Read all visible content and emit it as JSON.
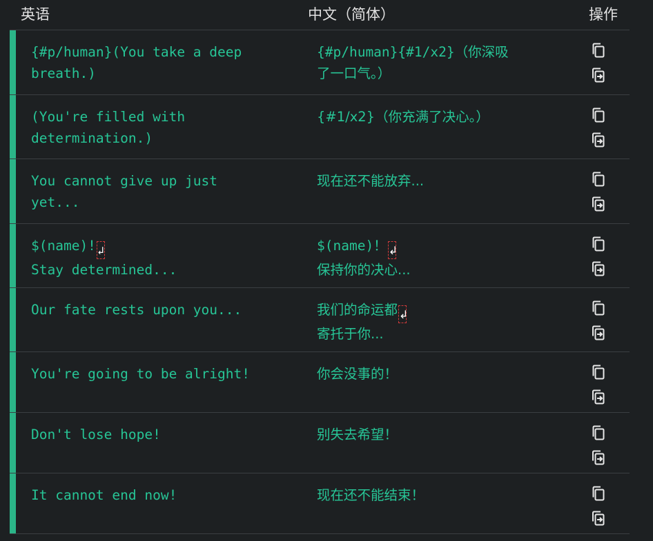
{
  "header": {
    "col_english": "英语",
    "col_chinese": "中文（简体）",
    "col_actions": "操作"
  },
  "rows": [
    {
      "en_lines": [
        "{#p/human}(You take a deep",
        "breath.)"
      ],
      "zh_lines": [
        "{#p/human}{#1/x2}（你深吸",
        "了一口气。）"
      ]
    },
    {
      "en_lines": [
        "(You're filled with",
        "determination.)"
      ],
      "zh_lines": [
        "{#1/x2}（你充满了决心。）"
      ]
    },
    {
      "en_lines": [
        "You cannot give up just",
        "yet..."
      ],
      "zh_lines": [
        "现在还不能放弃..."
      ]
    },
    {
      "en_lines": [
        "$(name)!",
        "Stay determined..."
      ],
      "zh_lines": [
        "$(name)！",
        "保持你的决心..."
      ],
      "line_break_marker": "↲"
    },
    {
      "en_lines": [
        "Our fate rests upon you..."
      ],
      "zh_lines": [
        "我们的命运都",
        "寄托于你..."
      ],
      "line_break_marker": "↲"
    },
    {
      "en_lines": [
        "You're going to be alright!"
      ],
      "zh_lines": [
        "你会没事的！"
      ]
    },
    {
      "en_lines": [
        "Don't lose hope!"
      ],
      "zh_lines": [
        "别失去希望！"
      ]
    },
    {
      "en_lines": [
        "It cannot end now!"
      ],
      "zh_lines": [
        "现在还不能结束！"
      ]
    }
  ],
  "actions": {
    "copy_icon": "copy-icon",
    "copy_to_translation_icon": "copy-to-translation-icon"
  },
  "colors": {
    "background": "#1d2022",
    "text_accent": "#27c596",
    "row_marker": "#2bb588",
    "divider": "#3b3f42",
    "linebreak_marker_border": "#d23b3b"
  }
}
